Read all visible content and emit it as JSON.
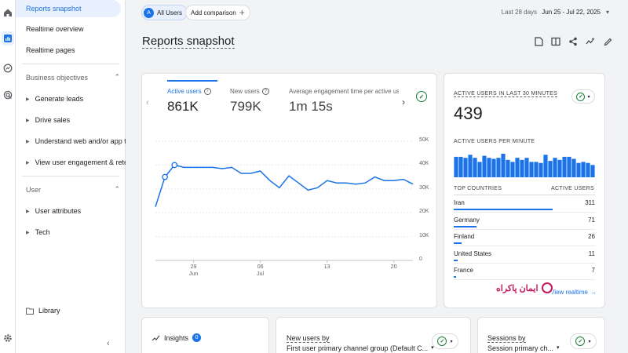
{
  "nav": {
    "top_items": [
      "Reports snapshot",
      "Realtime overview",
      "Realtime pages"
    ],
    "section_business": "Business objectives",
    "business_items": [
      "Generate leads",
      "Drive sales",
      "Understand web and/or app t...",
      "View user engagement & rete..."
    ],
    "section_user": "User",
    "user_items": [
      "User attributes",
      "Tech"
    ],
    "library": "Library"
  },
  "topbar": {
    "segment_initial": "A",
    "segment_label": "All Users",
    "add_comparison": "Add comparison",
    "date_prefix": "Last 28 days",
    "date_range": "Jun 25 - Jul 22, 2025"
  },
  "page_title": "Reports snapshot",
  "main_card": {
    "metrics": [
      {
        "label": "Active users",
        "value": "861K"
      },
      {
        "label": "New users",
        "value": "799K"
      },
      {
        "label": "Average engagement time per active us",
        "value": "1m 15s"
      }
    ],
    "y_ticks": [
      "50K",
      "40K",
      "30K",
      "20K",
      "10K",
      "0"
    ],
    "x_ticks": [
      {
        "day": "29",
        "month": "Jun"
      },
      {
        "day": "06",
        "month": "Jul"
      },
      {
        "day": "13",
        "month": ""
      },
      {
        "day": "20",
        "month": ""
      }
    ]
  },
  "chart_data": {
    "type": "line",
    "title": "",
    "series": [
      {
        "name": "Active users",
        "values": [
          22500,
          35000,
          40000,
          39000,
          39000,
          39000,
          39000,
          38500,
          39000,
          36500,
          36500,
          37500,
          33500,
          30500,
          35500,
          32500,
          29500,
          30500,
          33500,
          32500,
          32500,
          32000,
          32500,
          35000,
          33500,
          33500,
          34000,
          32000
        ]
      }
    ],
    "x": [
      "Jun 25",
      "Jun 26",
      "Jun 27",
      "Jun 28",
      "Jun 29",
      "Jun 30",
      "Jul 1",
      "Jul 2",
      "Jul 3",
      "Jul 4",
      "Jul 5",
      "Jul 6",
      "Jul 7",
      "Jul 8",
      "Jul 9",
      "Jul 10",
      "Jul 11",
      "Jul 12",
      "Jul 13",
      "Jul 14",
      "Jul 15",
      "Jul 16",
      "Jul 17",
      "Jul 18",
      "Jul 19",
      "Jul 20",
      "Jul 21",
      "Jul 22"
    ],
    "ylim": [
      0,
      50000
    ],
    "grid": true
  },
  "realtime_card": {
    "title": "ACTIVE USERS IN LAST 30 MINUTES",
    "value": "439",
    "per_minute_label": "ACTIVE USERS PER MINUTE",
    "per_minute_values": [
      20,
      20,
      19,
      22,
      19,
      15,
      21,
      19,
      18,
      19,
      23,
      17,
      15,
      19,
      17,
      19,
      15,
      15,
      14,
      22,
      16,
      19,
      17,
      20,
      20,
      18,
      14,
      15,
      14,
      12
    ],
    "countries_header": "TOP COUNTRIES",
    "active_users_header": "ACTIVE USERS",
    "countries": [
      {
        "name": "Iran",
        "value": "311",
        "fraction": 1.0
      },
      {
        "name": "Germany",
        "value": "71",
        "fraction": 0.23
      },
      {
        "name": "Finland",
        "value": "26",
        "fraction": 0.08
      },
      {
        "name": "United States",
        "value": "11",
        "fraction": 0.04
      },
      {
        "name": "France",
        "value": "7",
        "fraction": 0.02
      }
    ],
    "view_realtime": "View realtime",
    "watermark_text": "ایمان پاکراه"
  },
  "bottom": {
    "insights_label": "Insights",
    "insights_count": "0",
    "new_users_by": "New users by",
    "new_users_dim": "First user primary channel group (Default C...",
    "sessions_by": "Sessions by",
    "sessions_dim": "Session primary ch..."
  },
  "colors": {
    "accent": "#1a73e8",
    "success": "#188038",
    "brand_watermark": "#c2185b"
  }
}
